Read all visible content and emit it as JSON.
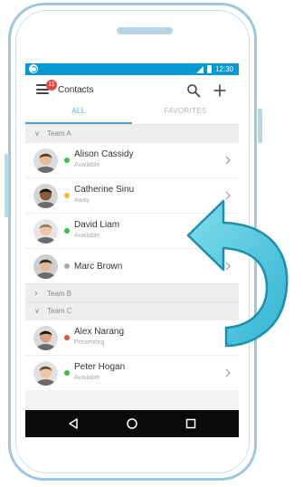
{
  "status_bar": {
    "time": "12:30"
  },
  "header": {
    "title": "Contacts",
    "notification_count": "11"
  },
  "tabs": [
    {
      "label": "ALL",
      "active": true
    },
    {
      "label": "FAVORITES",
      "active": false
    }
  ],
  "groups": [
    {
      "name": "Team A",
      "expanded": true,
      "contacts": [
        {
          "name": "Alison Cassidy",
          "status": "Available",
          "presence_color": "#3dbd4a"
        },
        {
          "name": "Catherine Sinu",
          "status": "Away",
          "presence_color": "#f4b82b"
        },
        {
          "name": "David Liam",
          "status": "Available",
          "presence_color": "#3dbd4a"
        },
        {
          "name": "Marc Brown",
          "status": "",
          "presence_color": "#a8a8a8"
        }
      ]
    },
    {
      "name": "Team B",
      "expanded": false,
      "contacts": []
    },
    {
      "name": "Team C",
      "expanded": true,
      "contacts": [
        {
          "name": "Alex Narang",
          "status": "Presenting",
          "presence_color": "#e8502f"
        },
        {
          "name": "Peter Hogan",
          "status": "Available",
          "presence_color": "#3dbd4a"
        }
      ]
    }
  ],
  "colors": {
    "status_bar": "#0599d4",
    "accent": "#4aa7dc",
    "badge": "#e8473f",
    "phone_frame": "#9fc6dc",
    "swipe_arrow": "#4fc3da"
  },
  "icons": {
    "menu": "hamburger-icon",
    "search": "search-icon",
    "add": "plus-icon",
    "row": "chevron-right-icon",
    "collapse": "chevron-down-icon",
    "expand": "chevron-right-icon",
    "nav_back": "back-triangle-icon",
    "nav_home": "home-circle-icon",
    "nav_recent": "recent-square-icon",
    "gesture": "swipe-left-arrow-icon"
  }
}
